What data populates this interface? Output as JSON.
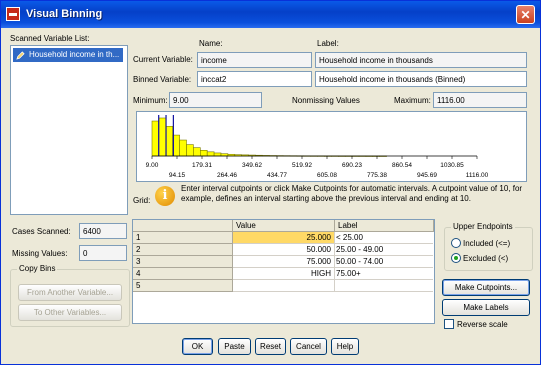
{
  "window": {
    "title": "Visual Binning",
    "close": "✕"
  },
  "scanned": {
    "label": "Scanned Variable List:",
    "item": "Household income in th..."
  },
  "cases_scanned": {
    "label": "Cases Scanned:",
    "value": "6400"
  },
  "missing_values": {
    "label": "Missing Values:",
    "value": "0"
  },
  "copy_bins": {
    "title": "Copy Bins",
    "from_button": "From Another Variable...",
    "to_button": "To Other Variables..."
  },
  "columns": {
    "name": "Name:",
    "label": "Label:"
  },
  "current": {
    "label": "Current Variable:",
    "name": "income",
    "var_label": "Household income in thousands"
  },
  "binned": {
    "label": "Binned Variable:",
    "name": "inccat2",
    "var_label": "Household income in thousands (Binned)"
  },
  "stats": {
    "min_label": "Minimum:",
    "min_value": "9.00",
    "nonmissing_label": "Nonmissing Values",
    "max_label": "Maximum:",
    "max_value": "1116.00"
  },
  "histogram": {
    "bars": [
      0.92,
      1.0,
      0.78,
      0.55,
      0.42,
      0.3,
      0.22,
      0.15,
      0.11,
      0.08,
      0.06,
      0.045,
      0.035,
      0.03,
      0.025,
      0.02,
      0.015,
      0.012,
      0.01,
      0.008,
      0.007,
      0.006,
      0.005,
      0.004,
      0.004,
      0.003,
      0.003,
      0.002,
      0.002,
      0.002,
      0.002,
      0.001,
      0.001,
      0.001
    ],
    "cutpoints": [
      25,
      50,
      75
    ],
    "xmin": 9.0,
    "xmax": 1116.0,
    "ticks_top": [
      "9.00",
      "179.31",
      "349.62",
      "519.92",
      "690.23",
      "860.54",
      "1030.85"
    ],
    "ticks_bottom": [
      "94.15",
      "264.46",
      "434.77",
      "605.08",
      "775.38",
      "945.69",
      "1116.00"
    ]
  },
  "grid": {
    "label": "Grid:",
    "instructions": "Enter interval cutpoints or click Make Cutpoints for automatic intervals. A cutpoint value of 10, for example, defines an interval starting above the previous interval and ending at 10.",
    "col_value": "Value",
    "col_label": "Label",
    "rows": [
      {
        "num": "1",
        "value": "25.000",
        "label": "< 25.00"
      },
      {
        "num": "2",
        "value": "50.000",
        "label": "25.00 - 49.00"
      },
      {
        "num": "3",
        "value": "75.000",
        "label": "50.00 - 74.00"
      },
      {
        "num": "4",
        "value": "HIGH",
        "label": "75.00+"
      },
      {
        "num": "5",
        "value": "",
        "label": ""
      }
    ]
  },
  "upper_endpoints": {
    "title": "Upper Endpoints",
    "included": "Included (<=)",
    "excluded": "Excluded (<)",
    "selected": "excluded"
  },
  "buttons": {
    "make_cutpoints": "Make Cutpoints...",
    "make_labels": "Make Labels",
    "reverse_scale": "Reverse scale",
    "ok": "OK",
    "paste": "Paste",
    "reset": "Reset",
    "cancel": "Cancel",
    "help": "Help"
  },
  "colors": {
    "bars": "#ffff00",
    "bar_outline": "#7a7a00",
    "cutline": "#1010a0",
    "selected_cell": "#ffd966"
  }
}
